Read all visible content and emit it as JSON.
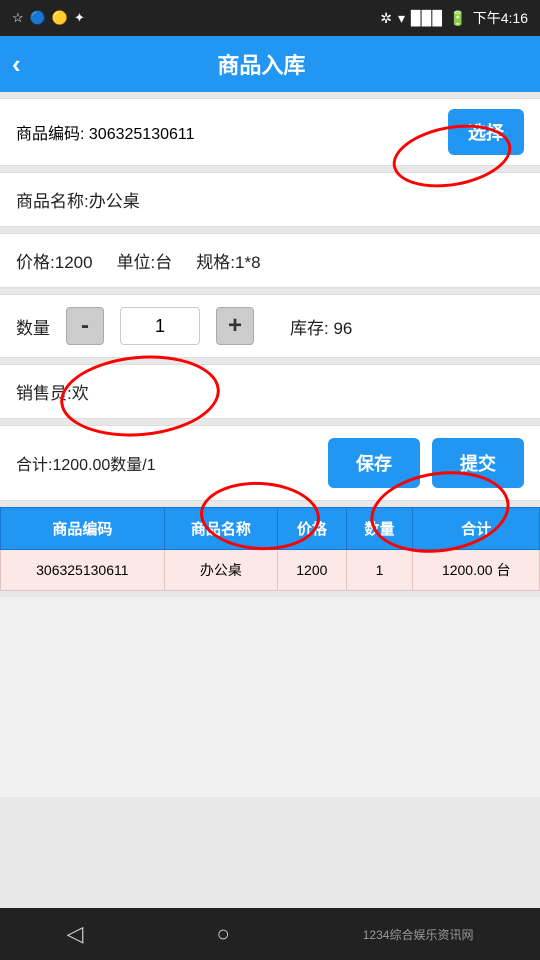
{
  "statusBar": {
    "leftIcons": [
      "☆",
      "●",
      "◑",
      "✦"
    ],
    "rightIcons": [
      "✲",
      "▾",
      "▉▉▉",
      "🔋"
    ],
    "time": "下午4:16"
  },
  "header": {
    "backLabel": "‹",
    "title": "商品入库"
  },
  "form": {
    "productCodeLabel": "商品编码:",
    "productCodeValue": "306325130611",
    "selectButtonLabel": "选择",
    "productNameLabel": "商品名称:",
    "productNameValue": "办公桌",
    "priceLabel": "价格:",
    "priceValue": "1200",
    "unitLabel": "单位:",
    "unitValue": "台",
    "specLabel": "规格:",
    "specValue": "1*8",
    "qtyLabel": "数量",
    "minusLabel": "-",
    "qtyValue": "1",
    "plusLabel": "+",
    "stockLabel": "库存:",
    "stockValue": "96",
    "salesPersonLabel": "销售员:",
    "salesPersonValue": "欢",
    "totalLabel": "合计:1200.00数量/1",
    "saveButtonLabel": "保存",
    "submitButtonLabel": "提交"
  },
  "table": {
    "columns": [
      "商品编码",
      "商品名称",
      "价格",
      "数量",
      "合计"
    ],
    "rows": [
      {
        "code": "306325130611",
        "name": "办公桌",
        "price": "1200",
        "qty": "1",
        "total": "1200.00",
        "extra": "台"
      }
    ]
  },
  "bottomNav": {
    "backIcon": "◁",
    "homeIcon": "○",
    "watermark": "1234综合娱乐资讯网"
  }
}
